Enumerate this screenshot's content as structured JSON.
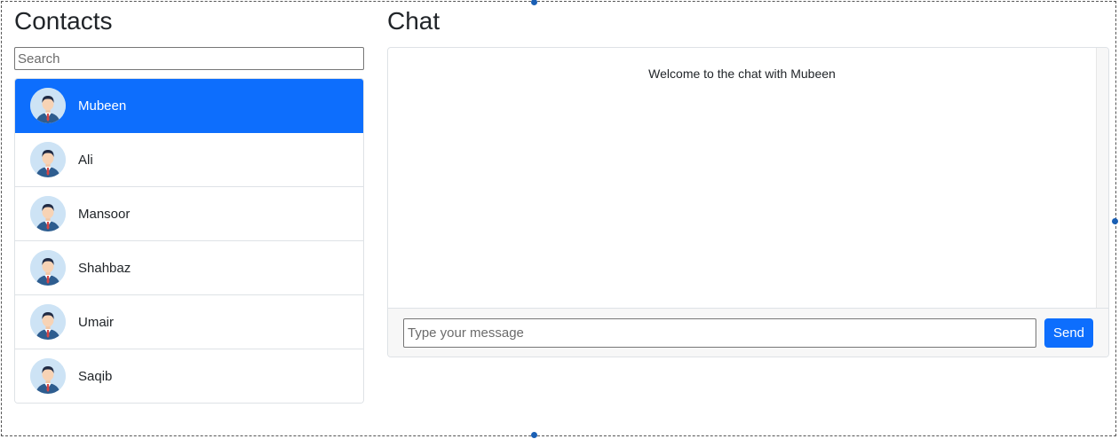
{
  "contacts": {
    "title": "Contacts",
    "search_placeholder": "Search",
    "items": [
      {
        "name": "Mubeen",
        "active": true
      },
      {
        "name": "Ali",
        "active": false
      },
      {
        "name": "Mansoor",
        "active": false
      },
      {
        "name": "Shahbaz",
        "active": false
      },
      {
        "name": "Umair",
        "active": false
      },
      {
        "name": "Saqib",
        "active": false
      }
    ]
  },
  "chat": {
    "title": "Chat",
    "welcome": "Welcome to the chat with Mubeen",
    "input_placeholder": "Type your message",
    "send_label": "Send"
  },
  "colors": {
    "accent": "#0d6efd",
    "avatar_bg": "#cde3f5"
  }
}
